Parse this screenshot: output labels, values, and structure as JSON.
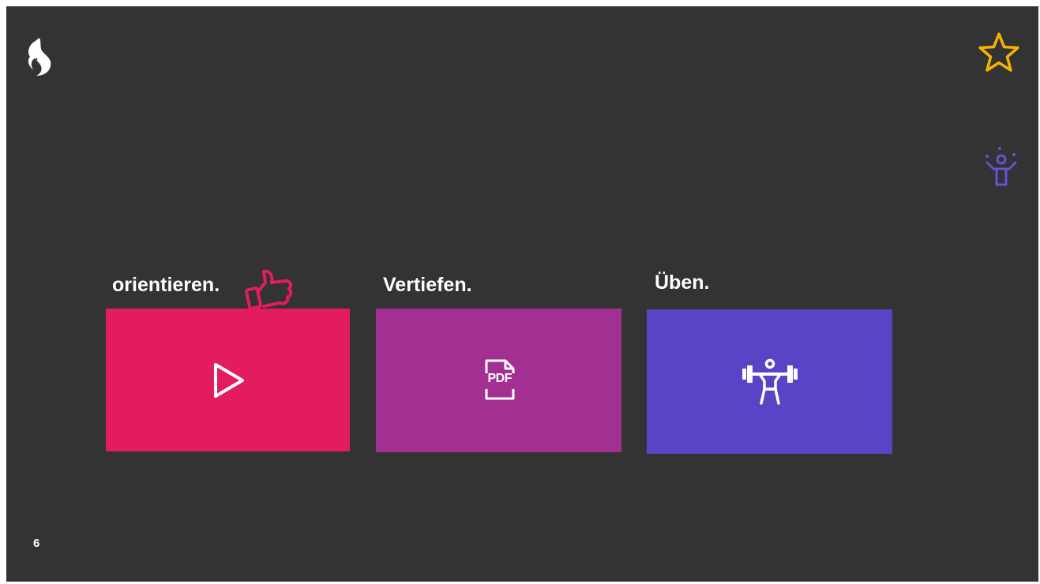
{
  "header": {
    "logo_icon": "swisscom-logo-icon",
    "favorite_icon": "star-icon",
    "profile_icon": "juggler-person-icon"
  },
  "sections": [
    {
      "label": "orientieren.",
      "icon": "play-icon",
      "color": "#E31C5F",
      "decoration_icon": "thumbs-up-icon"
    },
    {
      "label": "Vertiefen.",
      "icon": "pdf-document-icon",
      "color": "#A23093"
    },
    {
      "label": "Üben.",
      "icon": "weightlifter-icon",
      "color": "#5A44C5"
    }
  ],
  "footer": {
    "page_number": "6"
  },
  "colors": {
    "background": "#333333",
    "star": "#F5B300",
    "profile": "#6B4FD6",
    "thumb": "#E31C5F"
  }
}
